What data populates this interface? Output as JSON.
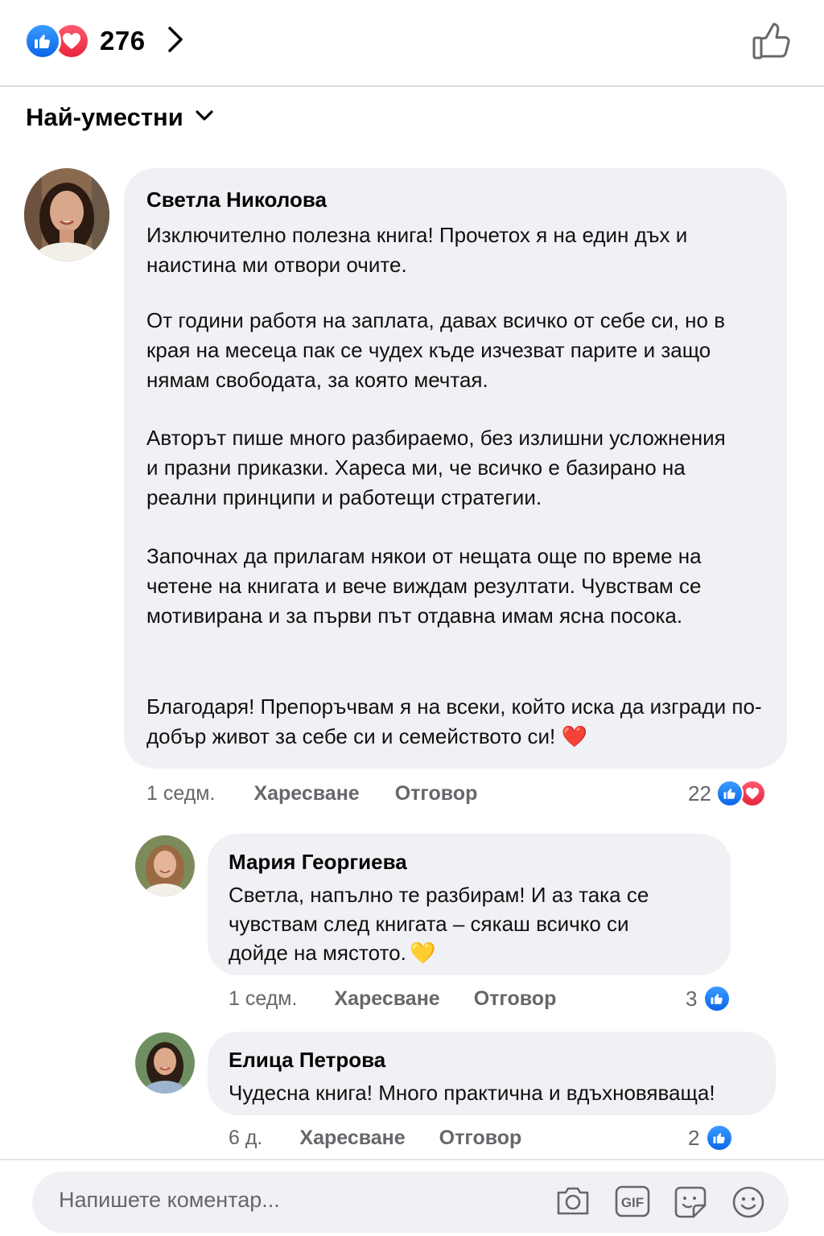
{
  "header": {
    "reaction_count": "276",
    "icons": [
      "like-icon",
      "love-icon",
      "chevron-right-icon",
      "thumbs-up-outline-icon"
    ]
  },
  "sort": {
    "label": "Най-уместни",
    "icon": "chevron-down-icon"
  },
  "comments": [
    {
      "author": "Светла Николова",
      "paragraphs": [
        "Изключително полезна книга! Прочетох я на един дъх и наистина ми отвори очите.",
        "От години работя на заплата, давах всичко от себе си, но в края на месеца пак се чудех къде изчезват парите и защо нямам свободата, за която мечтая.",
        "Авторът пише много разбираемо, без излишни усложнения и празни приказки. Хареса ми, че всичко е базирано на реални принципи и работещи стратегии.",
        "Започнах да прилагам някои от нещата още по време на четене на книгата и вече виждам резултати. Чувствам се мотивирана и за първи път отдавна имам ясна посока.",
        "Благодаря! Препоръчвам я на всеки, който иска да изгради по-добър живот за себе си и семейството си!"
      ],
      "emoji": "❤️",
      "time": "1 седм.",
      "like_label": "Харесване",
      "reply_label": "Отговор",
      "reaction_count": "22",
      "reactions": [
        "like",
        "love"
      ]
    }
  ],
  "replies": [
    {
      "author": "Мария Георгиева",
      "lines": [
        "Светла, напълно те разбирам! И аз така се",
        "чувствам след книгата – сякаш всичко си",
        "дойде на мястото."
      ],
      "emoji": "💛",
      "time": "1 седм.",
      "like_label": "Харесване",
      "reply_label": "Отговор",
      "reaction_count": "3",
      "reactions": [
        "like"
      ]
    },
    {
      "author": "Елица Петрова",
      "lines": [
        "Чудесна книга! Много практична и вдъхновяваща!"
      ],
      "time": "6 д.",
      "like_label": "Харесване",
      "reply_label": "Отговор",
      "reaction_count": "2",
      "reactions": [
        "like"
      ]
    }
  ],
  "composer": {
    "placeholder": "Напишете коментар...",
    "tools": [
      "camera-icon",
      "gif-icon",
      "sticker-icon",
      "emoji-icon"
    ],
    "gif_label": "GIF"
  },
  "colors": {
    "like_blue": "#1877f2",
    "love_red": "#e8253d",
    "bubble_bg": "#f0f1f4",
    "meta_gray": "#65676b"
  }
}
